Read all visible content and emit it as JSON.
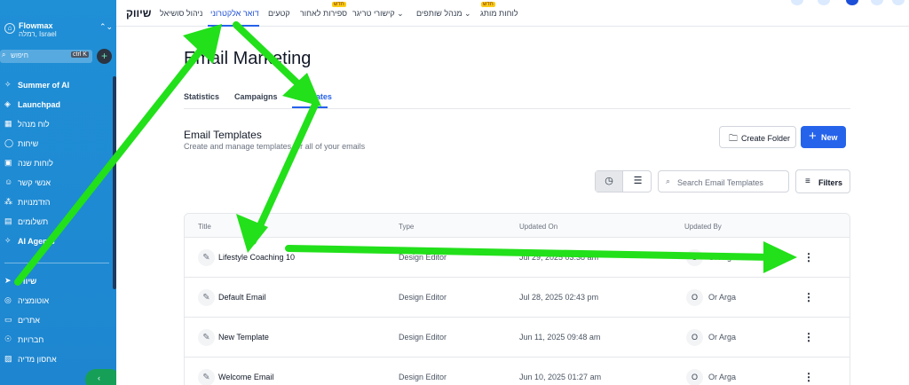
{
  "sidebar": {
    "account": {
      "name": "Flowmax",
      "location": "רמלה, Israel"
    },
    "search": {
      "placeholder": "חיפוש",
      "shortcut": "ctrl K"
    },
    "items": [
      {
        "label": "Summer of AI",
        "icon": "sparkles-icon",
        "glyph": "✧",
        "bold": true
      },
      {
        "label": "Launchpad",
        "icon": "rocket-icon",
        "glyph": "◈",
        "bold": true
      },
      {
        "label": "לוח מנהל",
        "icon": "dashboard-icon",
        "glyph": "▦",
        "bold": false
      },
      {
        "label": "שיחות",
        "icon": "chat-icon",
        "glyph": "◯",
        "bold": false
      },
      {
        "label": "לוחות שנה",
        "icon": "calendar-icon",
        "glyph": "▣",
        "bold": false
      },
      {
        "label": "אנשי קשר",
        "icon": "contacts-icon",
        "glyph": "☺",
        "bold": false
      },
      {
        "label": "הזדמנויות",
        "icon": "opportunities-icon",
        "glyph": "⁂",
        "bold": false
      },
      {
        "label": "תשלומים",
        "icon": "payments-icon",
        "glyph": "▤",
        "bold": false
      },
      {
        "label": "AI Agents",
        "icon": "ai-agents-icon",
        "glyph": "✧",
        "bold": true
      },
      {
        "label": "שיווק",
        "icon": "marketing-icon",
        "glyph": "➤",
        "bold": true
      },
      {
        "label": "אוטומציה",
        "icon": "automation-icon",
        "glyph": "◎",
        "bold": false
      },
      {
        "label": "אתרים",
        "icon": "sites-icon",
        "glyph": "▭",
        "bold": false
      },
      {
        "label": "חברויות",
        "icon": "memberships-icon",
        "glyph": "☉",
        "bold": false
      },
      {
        "label": "אחסון מדיה",
        "icon": "media-icon",
        "glyph": "▨",
        "bold": false
      }
    ]
  },
  "topbar": {
    "brand": "שיווק",
    "tabs": [
      {
        "label": "ניהול סושיאל"
      },
      {
        "label": "דואר אלקטרוני",
        "active": true
      },
      {
        "label": "קטעים"
      },
      {
        "label": "ספירות לאחור",
        "badge": "חדש"
      },
      {
        "label": "קישורי טריגר ⌄"
      },
      {
        "label": "מנהל שותפים ⌄"
      },
      {
        "label": "לוחות מותג",
        "badge": "חדש"
      }
    ]
  },
  "page": {
    "title": "Email Marketing",
    "subtabs": [
      "Statistics",
      "Campaigns",
      "Templates"
    ],
    "section_title": "Email Templates",
    "section_subtitle": "Create and manage templates for all of your emails",
    "create_folder": "Create Folder",
    "new_button": "New",
    "search_placeholder": "Search Email Templates",
    "filters": "Filters"
  },
  "table": {
    "columns": [
      "Title",
      "Type",
      "Updated On",
      "Updated By"
    ],
    "rows": [
      {
        "title": "Lifestyle Coaching 10",
        "type": "Design Editor",
        "updated_on": "Jul 29, 2025 03:38 am",
        "initial": "O",
        "updated_by": "Or Arga"
      },
      {
        "title": "Default Email",
        "type": "Design Editor",
        "updated_on": "Jul 28, 2025 02:43 pm",
        "initial": "O",
        "updated_by": "Or Arga"
      },
      {
        "title": "New Template",
        "type": "Design Editor",
        "updated_on": "Jun 11, 2025 09:48 am",
        "initial": "O",
        "updated_by": "Or Arga"
      },
      {
        "title": "Welcome Email",
        "type": "Design Editor",
        "updated_on": "Jun 10, 2025 01:27 am",
        "initial": "O",
        "updated_by": "Or Arga"
      }
    ]
  },
  "colors": {
    "accent": "#2563eb",
    "sidebar": "#1f8fd6",
    "annotation_arrow": "#22e01a"
  }
}
